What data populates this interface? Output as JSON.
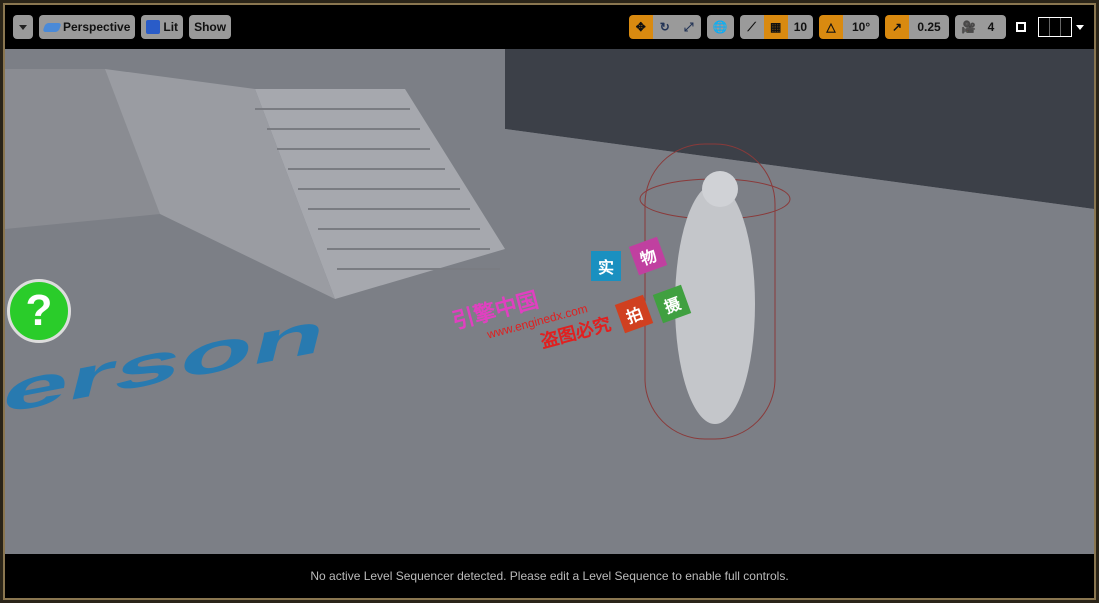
{
  "toolbar": {
    "menu_icon": "chevron-down-icon",
    "perspective_label": "Perspective",
    "lit_label": "Lit",
    "show_label": "Show",
    "grid_snap_value": "10",
    "rotation_snap_value": "10°",
    "scale_snap_value": "0.25",
    "camera_speed_value": "4",
    "accent_color": "#d98a10"
  },
  "viewport": {
    "floor_text": "erson",
    "help_icon_label": "?",
    "watermark": {
      "line1": "引擎中国",
      "line2": "www.enginedx.com",
      "line3": "盗图必究",
      "tiles": [
        "实",
        "物",
        "拍",
        "摄"
      ]
    }
  },
  "status_bar": {
    "message": "No active Level Sequencer detected. Please edit a Level Sequence to enable full controls."
  }
}
